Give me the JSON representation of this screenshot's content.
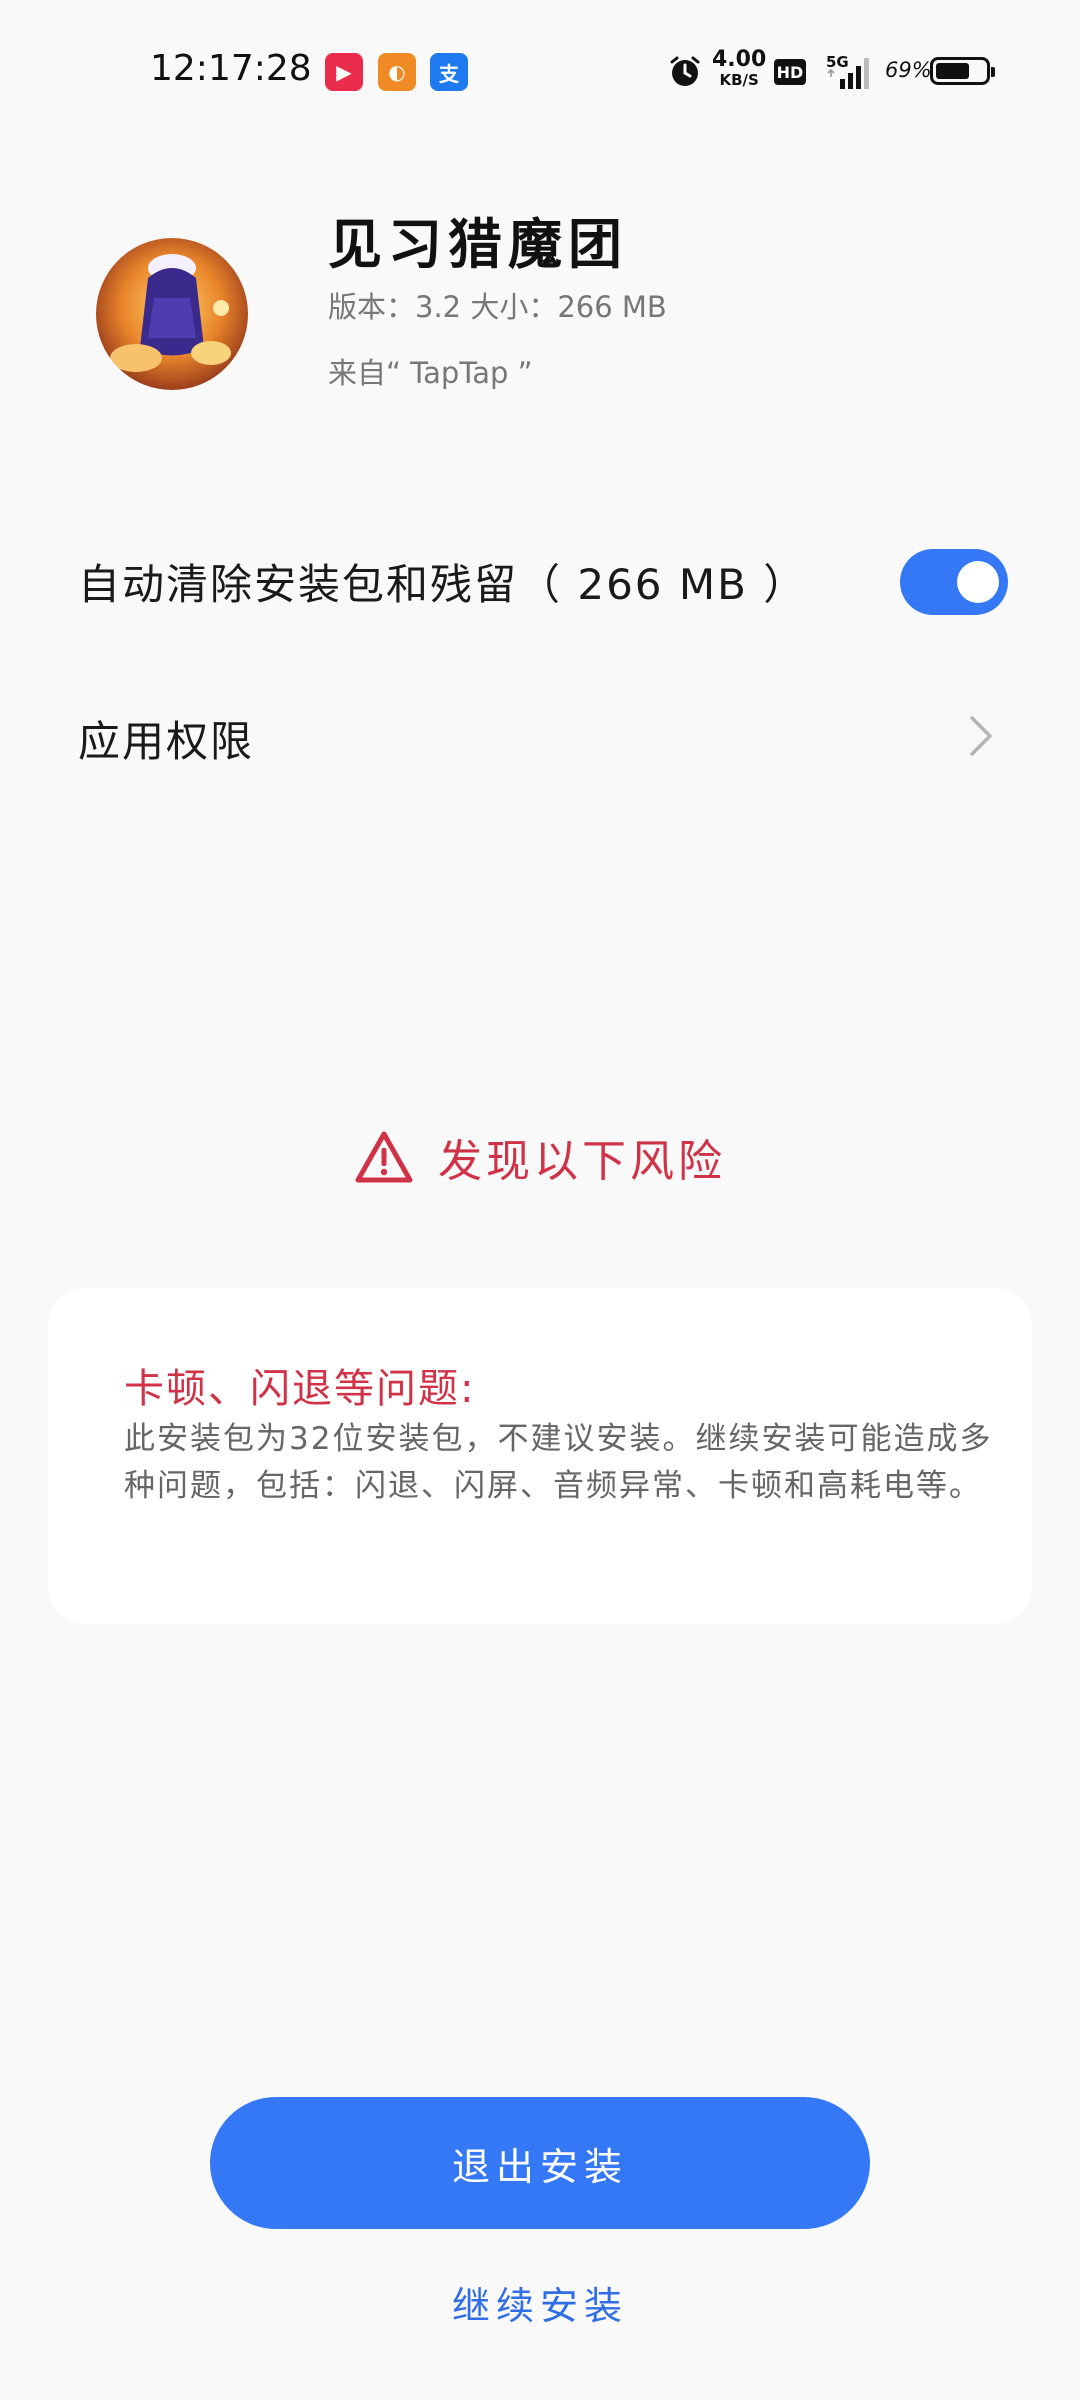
{
  "status_bar": {
    "time": "12:17:28",
    "net_speed_value": "4.00",
    "net_speed_unit": "KB/S",
    "hd_label": "HD",
    "network_type": "5G",
    "battery_percent": "69%",
    "battery_level": 0.69,
    "notification_icons": [
      "kuaishou-app-icon",
      "uc-browser-icon",
      "alipay-icon"
    ]
  },
  "app": {
    "name": "见习猎魔团",
    "meta": "版本：3.2   大小：266 MB",
    "source": "来自“ TapTap ”"
  },
  "settings": {
    "auto_clean_label": "自动清除安装包和残留（ 266 MB ）",
    "auto_clean_enabled": true,
    "permissions_label": "应用权限"
  },
  "risk": {
    "title": "发现以下风险",
    "card_heading": "卡顿、闪退等问题:",
    "card_body": "此安装包为32位安装包，不建议安装。继续安装可能造成多种问题，包括：闪退、闪屏、音频异常、卡顿和高耗电等。"
  },
  "actions": {
    "exit_label": "退出安装",
    "continue_label": "继续安装"
  },
  "colors": {
    "accent": "#3478f6",
    "danger": "#d03347",
    "background": "#f9f9f9"
  }
}
